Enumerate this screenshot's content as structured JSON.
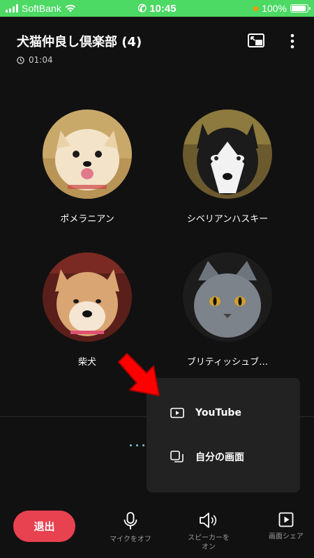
{
  "status_bar": {
    "carrier": "SoftBank",
    "time": "10:45",
    "battery_text": "100%",
    "battery_level": 1.0
  },
  "header": {
    "title": "犬猫仲良し倶楽部 (4)",
    "elapsed": "01:04"
  },
  "members": [
    {
      "name": "ポメラニアン"
    },
    {
      "name": "シベリアンハスキー"
    },
    {
      "name": "柴犬"
    },
    {
      "name": "ブリティッシュブ…"
    }
  ],
  "share_menu": {
    "items": [
      {
        "label": "YouTube",
        "icon": "youtube-icon"
      },
      {
        "label": "自分の画面",
        "icon": "screen-share-icon"
      }
    ]
  },
  "bottom_bar": {
    "exit_label": "退出",
    "mic_label": "マイクをオフ",
    "speaker_label": "スピーカーを\nオン",
    "screenshare_label": "画面シェア"
  },
  "colors": {
    "exit": "#e8414f",
    "status_bar": "#4cd964",
    "annotation_arrow": "#ff0000"
  }
}
